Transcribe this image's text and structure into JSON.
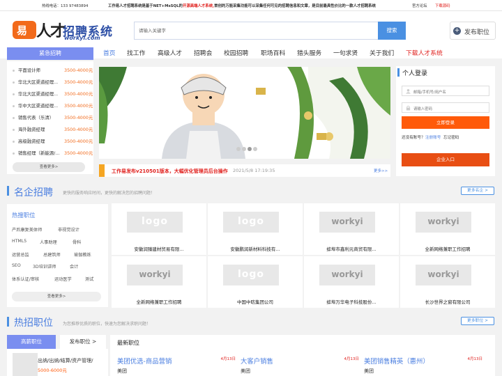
{
  "topbar": {
    "hotline": "热线电话：133 97483894",
    "desc_prefix": "工作易人才招聘系统是基于NET+MsSQL的",
    "desc_highlight": "开源高端人才系统,",
    "desc_suffix": "首创的万能采集功能可以采集任何可见的招聘信息和文章，是目前最具性价比的一款人才招聘系统",
    "forum": "官方论坛",
    "download": "下载源码"
  },
  "header": {
    "logo_mark": "易",
    "logo_rencai": "人才",
    "logo_cn": "招聘系统",
    "logo_url": "workyi.com",
    "search_placeholder": "请输入关键字",
    "search_button": "搜索",
    "post_job": "发布职位"
  },
  "nav": {
    "urgent": "紧急招聘",
    "items": [
      "首页",
      "找工作",
      "高级人才",
      "招聘会",
      "校园招聘",
      "职场百科",
      "猎头服务",
      "一句求贤",
      "关于我们",
      "下载人才系统"
    ]
  },
  "urgent_jobs": [
    {
      "title": "平面设计师",
      "salary": "3500-4000元"
    },
    {
      "title": "华北大区渠道经理...",
      "salary": "3500-4000元"
    },
    {
      "title": "华北大区渠道经理...",
      "salary": "3500-4000元"
    },
    {
      "title": "华中大区渠道经理...",
      "salary": "3500-4000元"
    },
    {
      "title": "销售代表（乐清）",
      "salary": "3500-4000元"
    },
    {
      "title": "海外融资经理",
      "salary": "3500-4000元"
    },
    {
      "title": "高级融资经理",
      "salary": "3500-4000元"
    },
    {
      "title": "销售经理（新能源/...",
      "salary": "3500-4000元"
    }
  ],
  "urgent_more": "查看更多>",
  "news": {
    "title": "工作易发布v210501版本，大幅优化管理员后台操作",
    "time": "2021/5/8 17:19:35",
    "more": "更多>>"
  },
  "login": {
    "title": "个人登录",
    "user_placeholder": "邮箱/手机号/用户名",
    "pass_placeholder": "请输入密码",
    "login_button": "立即登录",
    "no_account": "还没有账号？",
    "register": "注册账号",
    "forgot": "忘记密码",
    "enterprise": "企业入口"
  },
  "famous": {
    "title": "名企招聘",
    "subtitle": "更快的服务响应时间，更快的解决您的招聘问题！",
    "more": "更多名企 >"
  },
  "hot_tags": {
    "title": "热搜职位",
    "tags": [
      "产后康复美体师",
      "非视觉设计",
      "HTML5",
      "人事助理",
      "骨科",
      "运营总监",
      "总建筑师",
      "瑜伽教练",
      "SEO",
      "3D培训讲师",
      "会计",
      "体系认证/审核",
      "运动医学",
      "测试"
    ],
    "more": "查看更多>"
  },
  "companies": [
    {
      "name": "安徽润臻建材贸易有限...",
      "logo": "logo"
    },
    {
      "name": "安徽鹏润新材料科技有...",
      "logo": "logo"
    },
    {
      "name": "蚌埠市鑫利元商贸有限...",
      "logo": "workyi"
    },
    {
      "name": "全新网络兼职工作招聘",
      "logo": "workyi"
    },
    {
      "name": "全新网络兼职工作招聘",
      "logo": "workyi"
    },
    {
      "name": "中国中昉集团公司",
      "logo": "logo"
    },
    {
      "name": "蚌埠万华电子科技股份...",
      "logo": "workyi"
    },
    {
      "name": "长沙世界之窗有限公司",
      "logo": "workyi"
    }
  ],
  "hot_positions": {
    "title": "热招职位",
    "subtitle": "为您推荐优质的职位，快速为您解决求职问题！",
    "more": "更多职位 >",
    "tab_high": "高薪职位",
    "tab_post": "发布职位 >",
    "latest": "最新职位"
  },
  "left_card": {
    "title": "出纳/出纳/结算/资产管理/",
    "salary": "5000-6000元"
  },
  "latest_jobs": [
    {
      "title": "美团优选-商品营销",
      "date": "4月13日",
      "company": "美团"
    },
    {
      "title": "大客户销售",
      "date": "4月13日",
      "company": "美团"
    },
    {
      "title": "美团销售精英（惠州）",
      "date": "4月13日",
      "company": "美团"
    }
  ],
  "colors": {
    "accent": "#4a90e2",
    "orange": "#ff5a0a",
    "urgent_tab": "#7a8ef0",
    "red": "#e0201d"
  }
}
